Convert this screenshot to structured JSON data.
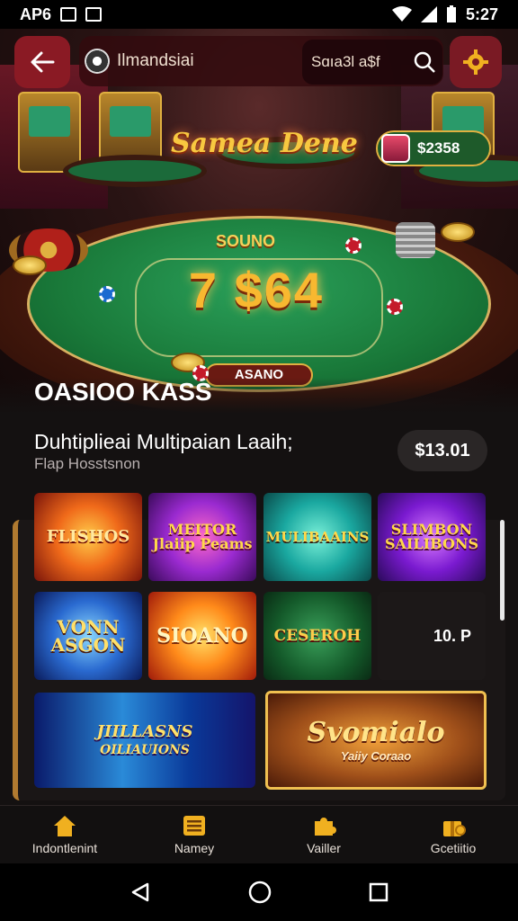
{
  "status_bar": {
    "left_text": "AP6",
    "time": "5:27"
  },
  "header": {
    "app_title": "Ilmandsiai",
    "search_value": "Sɑıa3l a$f",
    "back_icon": "arrow-left-icon",
    "settings_icon": "gear-icon"
  },
  "hero": {
    "logo_text": "Samea Dene",
    "table_label_top": "SOUNO",
    "table_digits": "7 $64",
    "table_badge": "ASANO",
    "balance": "$2358"
  },
  "section": {
    "heading": "OASIOO KASS",
    "subtitle": "Duhtiplieai Multipaian Laaih;",
    "caption": "Flap Hosstsnon",
    "price": "$13.01"
  },
  "games": [
    {
      "title": "FLISHOS",
      "style": "orange"
    },
    {
      "title": "MEITOR Jlaiip Peams",
      "style": "purple"
    },
    {
      "title": "MULIBAAINS",
      "style": "teal"
    },
    {
      "title": "SLIMBON SAILIBONS",
      "style": "violet"
    },
    {
      "title": "VONN ASGON",
      "style": "blue"
    },
    {
      "title": "SIOANO",
      "style": "fire"
    },
    {
      "title": "CESEROH",
      "style": "green"
    },
    {
      "title": "10. P",
      "style": "dark"
    },
    {
      "title": "JIILLASNS",
      "title2": "OILIAUIONS",
      "style": "ray"
    },
    {
      "title": "Svomialo",
      "subtitle": "Yaiiy Coraao",
      "style": "gold"
    }
  ],
  "bottom_nav": [
    {
      "label": "Indontlenint",
      "icon": "home-icon"
    },
    {
      "label": "Namey",
      "icon": "menu-list-icon"
    },
    {
      "label": "Vailler",
      "icon": "puzzle-icon"
    },
    {
      "label": "Gcetiitio",
      "icon": "gift-icon"
    }
  ],
  "colors": {
    "accent": "#8a1a24",
    "gold": "#e0b040",
    "felt": "#1a7a3a",
    "panel": "#141111"
  }
}
